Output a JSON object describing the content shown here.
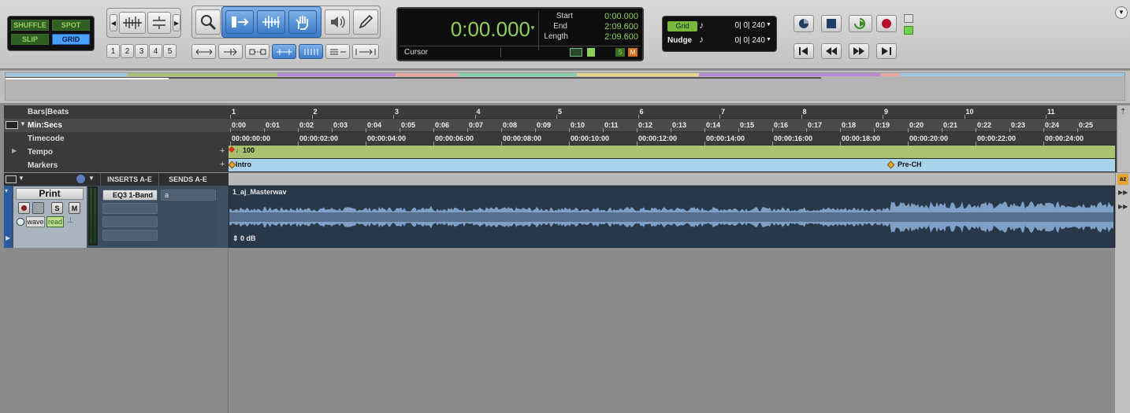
{
  "modes": {
    "shuffle": "SHUFFLE",
    "spot": "SPOT",
    "slip": "SLIP",
    "grid": "GRID"
  },
  "zoom_presets": [
    "1",
    "2",
    "3",
    "4",
    "5"
  ],
  "counter": {
    "main": "0:00.000",
    "start_label": "Start",
    "end_label": "End",
    "length_label": "Length",
    "start": "0:00.000",
    "end": "2:09.600",
    "length": "2:09.600",
    "cursor_label": "Cursor",
    "s_badge": "S",
    "m_badge": "M"
  },
  "grid": {
    "grid_label": "Grid",
    "grid_value": "0| 0| 240",
    "nudge_label": "Nudge",
    "nudge_value": "0| 0| 240"
  },
  "rulers": {
    "bars_label": "Bars|Beats",
    "minsecs_label": "Min:Secs",
    "timecode_label": "Timecode",
    "tempo_label": "Tempo",
    "markers_label": "Markers",
    "bars": [
      "1",
      "2",
      "3",
      "4",
      "5",
      "6",
      "7",
      "8",
      "9",
      "10",
      "11"
    ],
    "minsecs": [
      "0:00",
      "0:01",
      "0:02",
      "0:03",
      "0:04",
      "0:05",
      "0:06",
      "0:07",
      "0:08",
      "0:09",
      "0:10",
      "0:11",
      "0:12",
      "0:13",
      "0:14",
      "0:15",
      "0:16",
      "0:17",
      "0:18",
      "0:19",
      "0:20",
      "0:21",
      "0:22",
      "0:23",
      "0:24",
      "0:25"
    ],
    "timecode": [
      "00:00:00:00",
      "00:00:02:00",
      "00:00:04:00",
      "00:00:06:00",
      "00:00:08:00",
      "00:00:10:00",
      "00:00:12:00",
      "00:00:14:00",
      "00:00:16:00",
      "00:00:18:00",
      "00:00:20:00",
      "00:00:22:00",
      "00:00:24:00"
    ],
    "tempo_value": "100",
    "markers": [
      {
        "label": "Intro"
      },
      {
        "label": "Pre-CH"
      }
    ]
  },
  "track": {
    "inserts_header": "INSERTS A-E",
    "sends_header": "SENDS A-E",
    "name": "Print",
    "solo": "S",
    "mute": "M",
    "view": "wave",
    "automation": "read",
    "insert_1": "EQ3 1-Band",
    "send_1": "a",
    "clip_name": "1_aj_Masterwav",
    "clip_gain": "0 dB"
  },
  "colors": {
    "waveform": "#7f9fc6",
    "clip_bg": "#283849",
    "tempo_ruler": "#a9c06f",
    "marker_ruler": "#a9d3ea",
    "counter_green": "#8ed05a"
  },
  "icons": [
    "zoom-icon",
    "trim-icon",
    "selector-icon",
    "grabber-icon",
    "scrubber-icon",
    "pencil-icon",
    "speaker-icon",
    "online-icon",
    "stop-icon",
    "play-icon",
    "record-icon",
    "rewind-icon",
    "fast-forward-icon",
    "return-to-zero-icon",
    "go-to-end-icon"
  ]
}
